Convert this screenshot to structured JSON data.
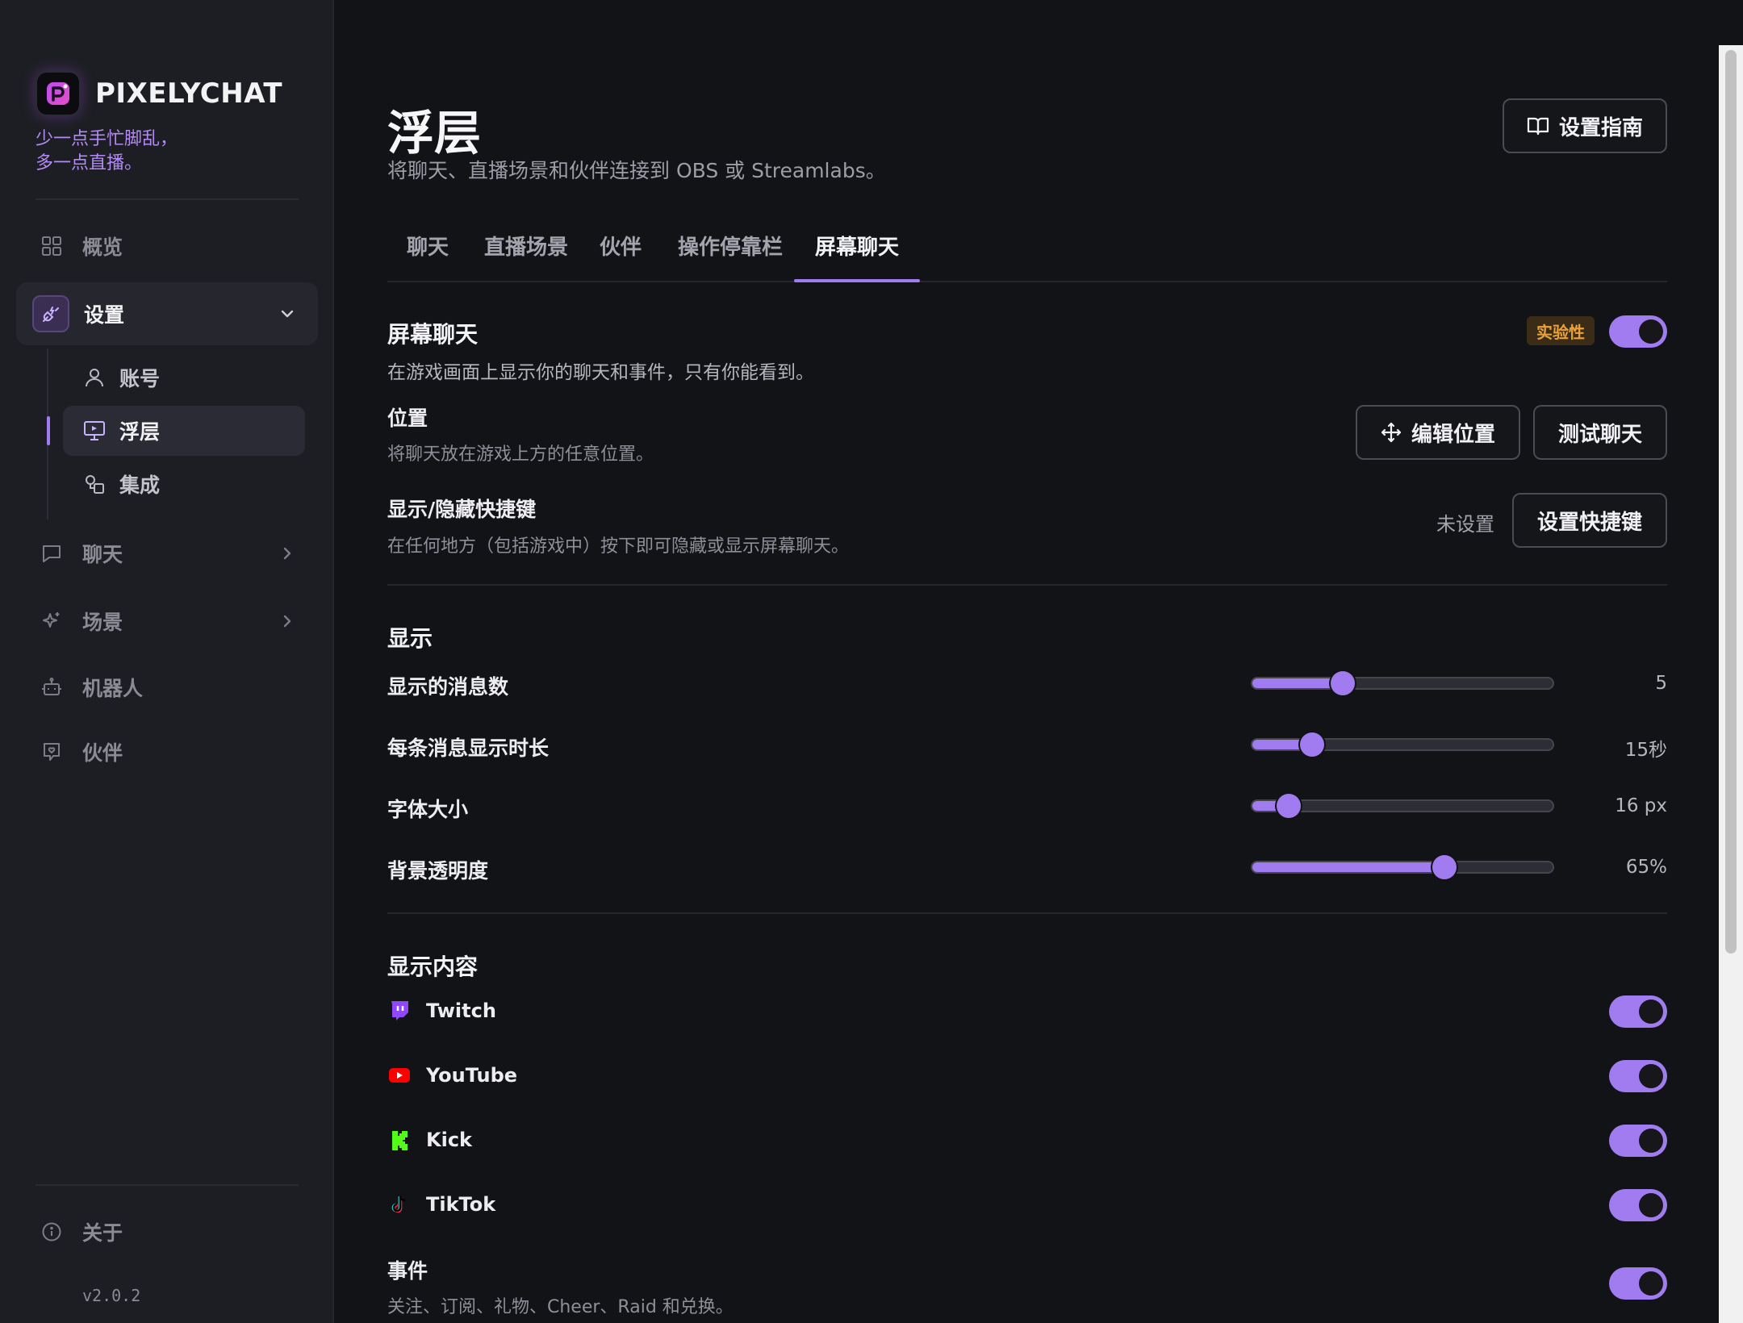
{
  "brand": {
    "name": "PIXELYCHAT",
    "tagline_line1": "少一点手忙脚乱，",
    "tagline_line2": "多一点直播。"
  },
  "sidebar": {
    "overview": "概览",
    "settings": "设置",
    "settings_children": {
      "account": "账号",
      "overlay": "浮层",
      "integrations": "集成"
    },
    "chat": "聊天",
    "scenes": "场景",
    "bots": "机器人",
    "partners": "伙伴",
    "about": "关于",
    "version": "v2.0.2"
  },
  "page": {
    "title": "浮层",
    "subtitle": "将聊天、直播场景和伙伴连接到 OBS 或 Streamlabs。",
    "guide_button": "设置指南"
  },
  "tabs": [
    "聊天",
    "直播场景",
    "伙伴",
    "操作停靠栏",
    "屏幕聊天"
  ],
  "active_tab_index": 4,
  "screen_chat": {
    "title": "屏幕聊天",
    "badge": "实验性",
    "enabled": true,
    "description": "在游戏画面上显示你的聊天和事件，只有你能看到。",
    "position": {
      "title": "位置",
      "description": "将聊天放在游戏上方的任意位置。",
      "edit_button": "编辑位置",
      "test_button": "测试聊天"
    },
    "hotkey": {
      "title": "显示/隐藏快捷键",
      "description": "在任何地方（包括游戏中）按下即可隐藏或显示屏幕聊天。",
      "status": "未设置",
      "set_button": "设置快捷键"
    }
  },
  "display": {
    "title": "显示",
    "sliders": [
      {
        "label": "显示的消息数",
        "value_text": "5",
        "fraction": 0.3
      },
      {
        "label": "每条消息显示时长",
        "value_text": "15秒",
        "fraction": 0.2
      },
      {
        "label": "字体大小",
        "value_text": "16 px",
        "fraction": 0.12
      },
      {
        "label": "背景透明度",
        "value_text": "65%",
        "fraction": 0.64
      }
    ]
  },
  "content": {
    "title": "显示内容",
    "platforms": [
      {
        "name": "Twitch",
        "icon": "twitch-icon",
        "color": "#9146ff",
        "enabled": true
      },
      {
        "name": "YouTube",
        "icon": "youtube-icon",
        "color": "#ff0000",
        "enabled": true
      },
      {
        "name": "Kick",
        "icon": "kick-icon",
        "color": "#53fc18",
        "enabled": true
      },
      {
        "name": "TikTok",
        "icon": "tiktok-icon",
        "color": "#000000",
        "enabled": true
      }
    ],
    "events": {
      "title": "事件",
      "description": "关注、订阅、礼物、Cheer、Raid 和兑换。",
      "enabled": true
    }
  },
  "colors": {
    "accent": "#a07cf0",
    "background": "#121316",
    "sidebar": "#1d1e23",
    "badge_text": "#e8a13c"
  }
}
